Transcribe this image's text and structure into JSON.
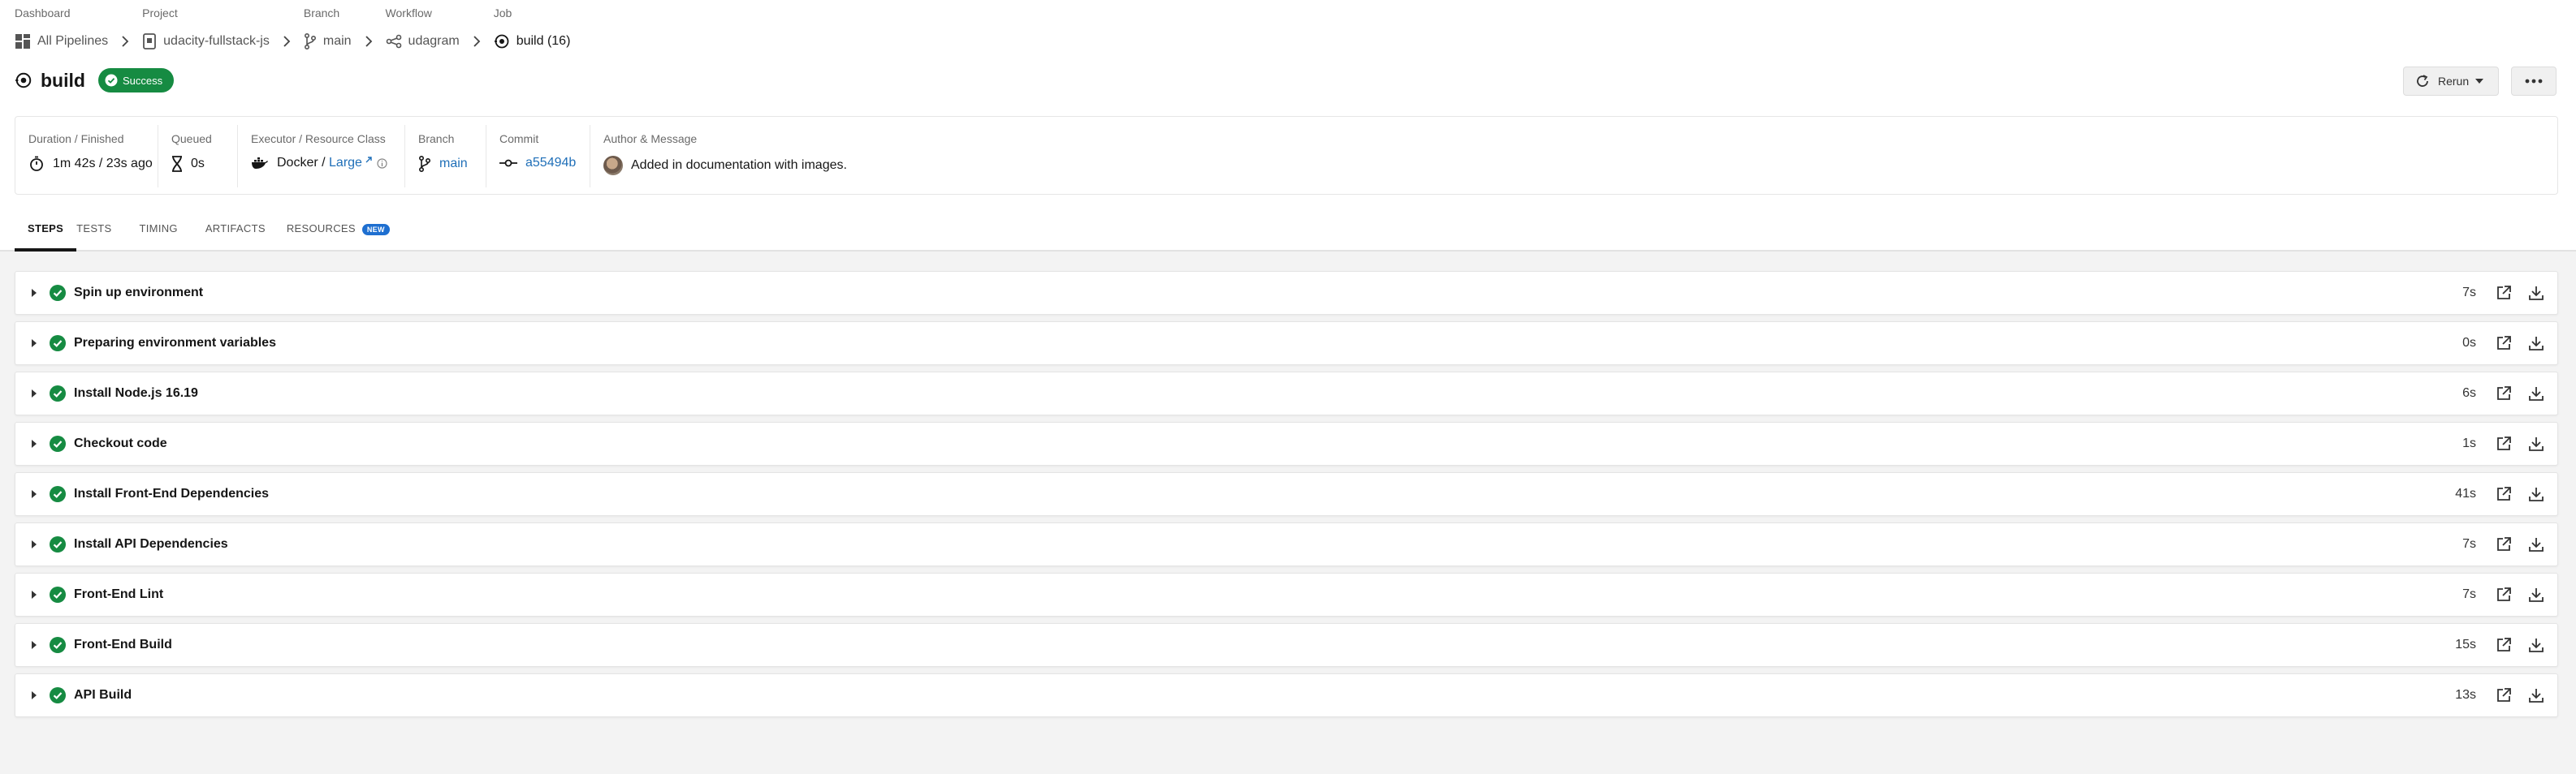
{
  "breadcrumb": {
    "dashboard": {
      "head": "Dashboard",
      "value": "All Pipelines"
    },
    "project": {
      "head": "Project",
      "value": "udacity-fullstack-js"
    },
    "branch": {
      "head": "Branch",
      "value": "main"
    },
    "workflow": {
      "head": "Workflow",
      "value": "udagram"
    },
    "job": {
      "head": "Job",
      "value": "build (16)"
    }
  },
  "job": {
    "title": "build",
    "status": "Success",
    "status_color": "#168b42",
    "rerun_label": "Rerun"
  },
  "info": {
    "duration": {
      "head": "Duration / Finished",
      "value": "1m 42s / 23s ago"
    },
    "queued": {
      "head": "Queued",
      "value": "0s"
    },
    "executor": {
      "head": "Executor / Resource Class",
      "executor": "Docker",
      "sep": " / ",
      "resource_class": "Large"
    },
    "branch": {
      "head": "Branch",
      "value": "main"
    },
    "commit": {
      "head": "Commit",
      "value": "a55494b"
    },
    "author": {
      "head": "Author & Message",
      "message": "Added in documentation with images."
    }
  },
  "tabs": [
    {
      "label": "STEPS"
    },
    {
      "label": "TESTS"
    },
    {
      "label": "TIMING"
    },
    {
      "label": "ARTIFACTS"
    },
    {
      "label": "RESOURCES",
      "badge": "NEW"
    }
  ],
  "steps": [
    {
      "name": "Spin up environment",
      "duration": "7s"
    },
    {
      "name": "Preparing environment variables",
      "duration": "0s"
    },
    {
      "name": "Install Node.js 16.19",
      "duration": "6s"
    },
    {
      "name": "Checkout code",
      "duration": "1s"
    },
    {
      "name": "Install Front-End Dependencies",
      "duration": "41s"
    },
    {
      "name": "Install API Dependencies",
      "duration": "7s"
    },
    {
      "name": "Front-End Lint",
      "duration": "7s"
    },
    {
      "name": "Front-End Build",
      "duration": "15s"
    },
    {
      "name": "API Build",
      "duration": "13s"
    }
  ],
  "colors": {
    "link": "#1f6fb8",
    "success": "#168b42",
    "badge_new": "#1e6fd0"
  }
}
